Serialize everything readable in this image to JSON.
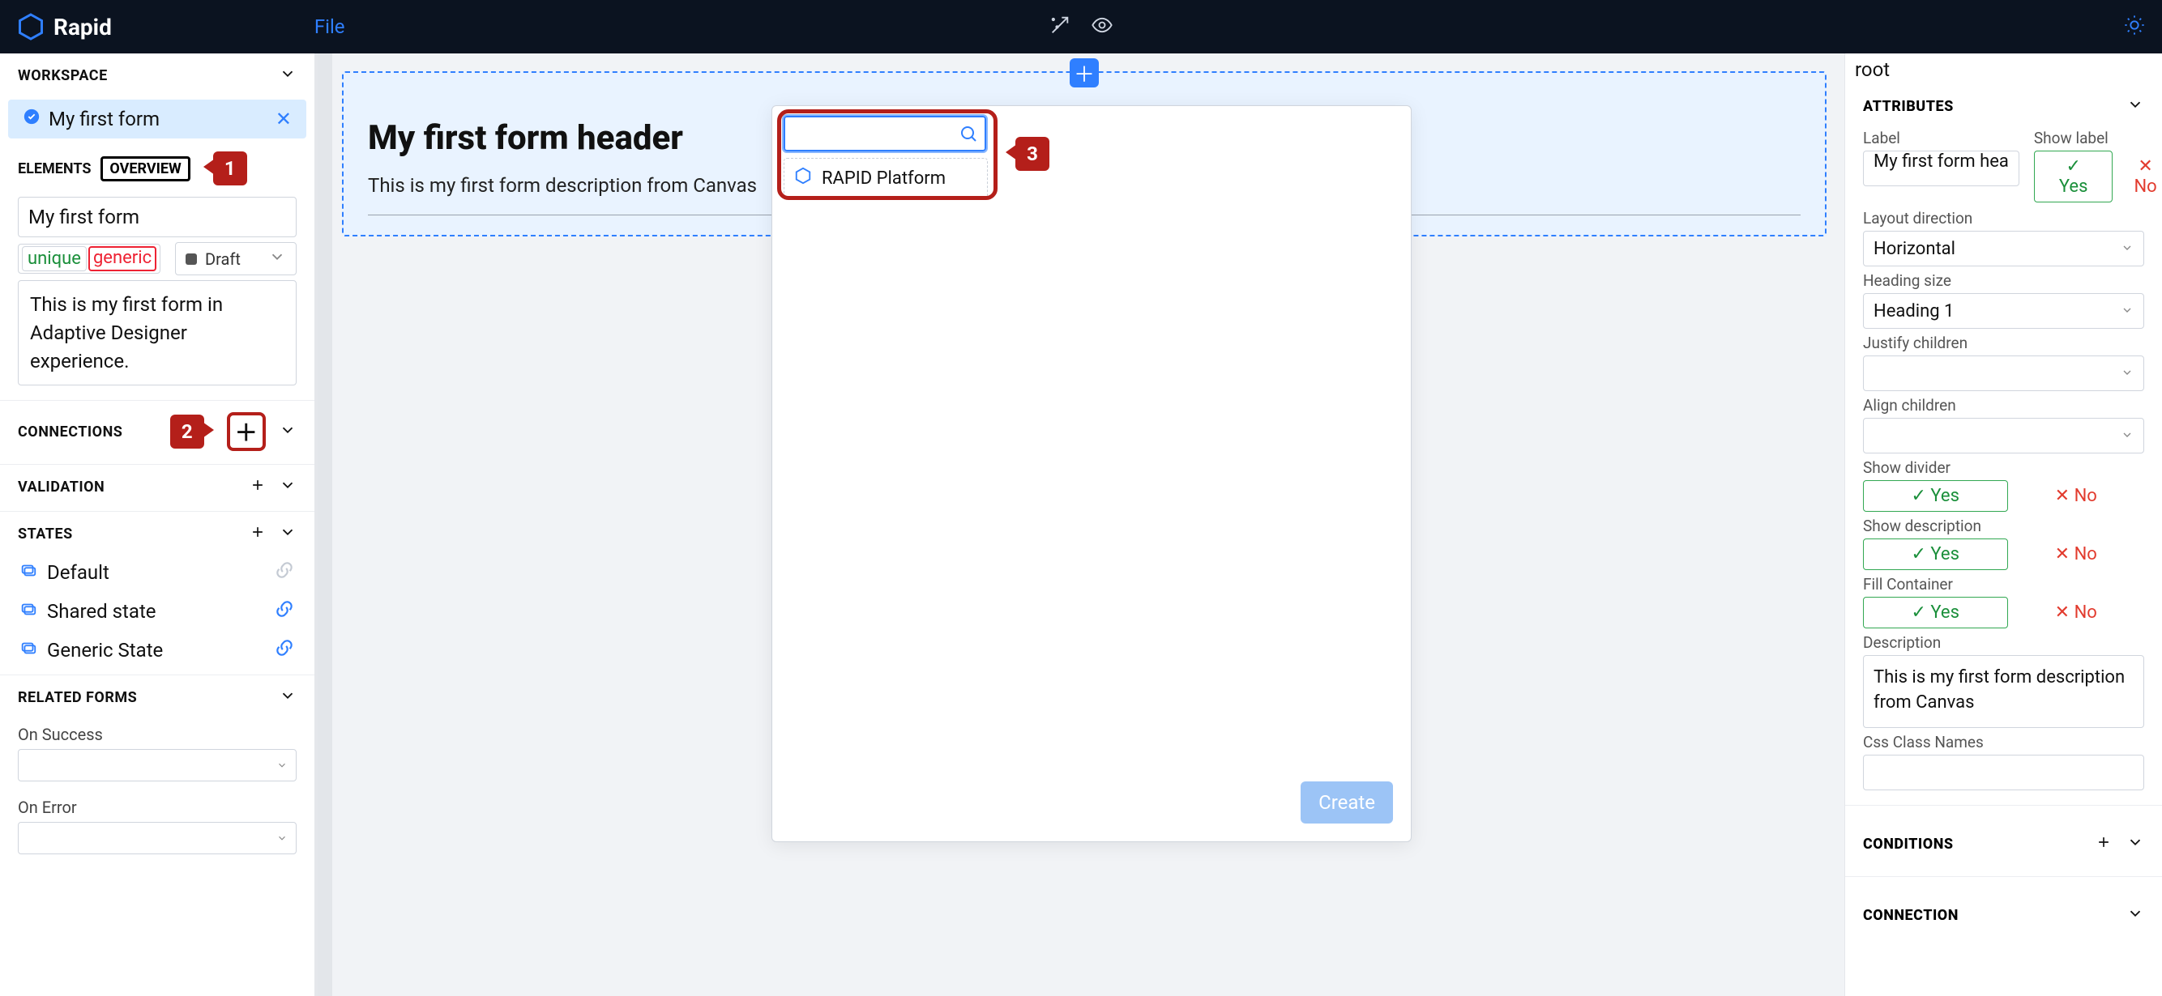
{
  "topbar": {
    "brand": "Rapid",
    "file": "File"
  },
  "workspace": {
    "title": "WORKSPACE",
    "item": "My first form"
  },
  "tabs": {
    "elements": "ELEMENTS",
    "overview": "OVERVIEW"
  },
  "overview": {
    "name": "My first form",
    "unique": "unique",
    "generic": "generic",
    "draft": "Draft",
    "description": "This is my first form in Adaptive Designer experience."
  },
  "connections": {
    "title": "CONNECTIONS"
  },
  "validation": {
    "title": "VALIDATION"
  },
  "states": {
    "title": "STATES",
    "items": [
      "Default",
      "Shared state",
      "Generic State"
    ]
  },
  "related": {
    "title": "RELATED FORMS",
    "onSuccess": "On Success",
    "onError": "On Error"
  },
  "canvas": {
    "header": "My first form header",
    "desc": "This is my first form description from Canvas"
  },
  "modal": {
    "option": "RAPID Platform",
    "create": "Create"
  },
  "callouts": {
    "c1": "1",
    "c2": "2",
    "c3": "3"
  },
  "right": {
    "root": "root",
    "attributes": "ATTRIBUTES",
    "labelLbl": "Label",
    "showLabelLbl": "Show label",
    "labelVal": "My first form hea",
    "layoutDirLbl": "Layout direction",
    "layoutDirVal": "Horizontal",
    "headingSizeLbl": "Heading size",
    "headingSizeVal": "Heading 1",
    "justifyLbl": "Justify children",
    "alignLbl": "Align children",
    "showDividerLbl": "Show divider",
    "showDescLbl": "Show description",
    "fillLbl": "Fill Container",
    "descLbl": "Description",
    "descVal": "This is my first form description from Canvas",
    "cssLbl": "Css Class Names",
    "yes": "Yes",
    "no": "No",
    "conditions": "CONDITIONS",
    "connection": "CONNECTION"
  }
}
